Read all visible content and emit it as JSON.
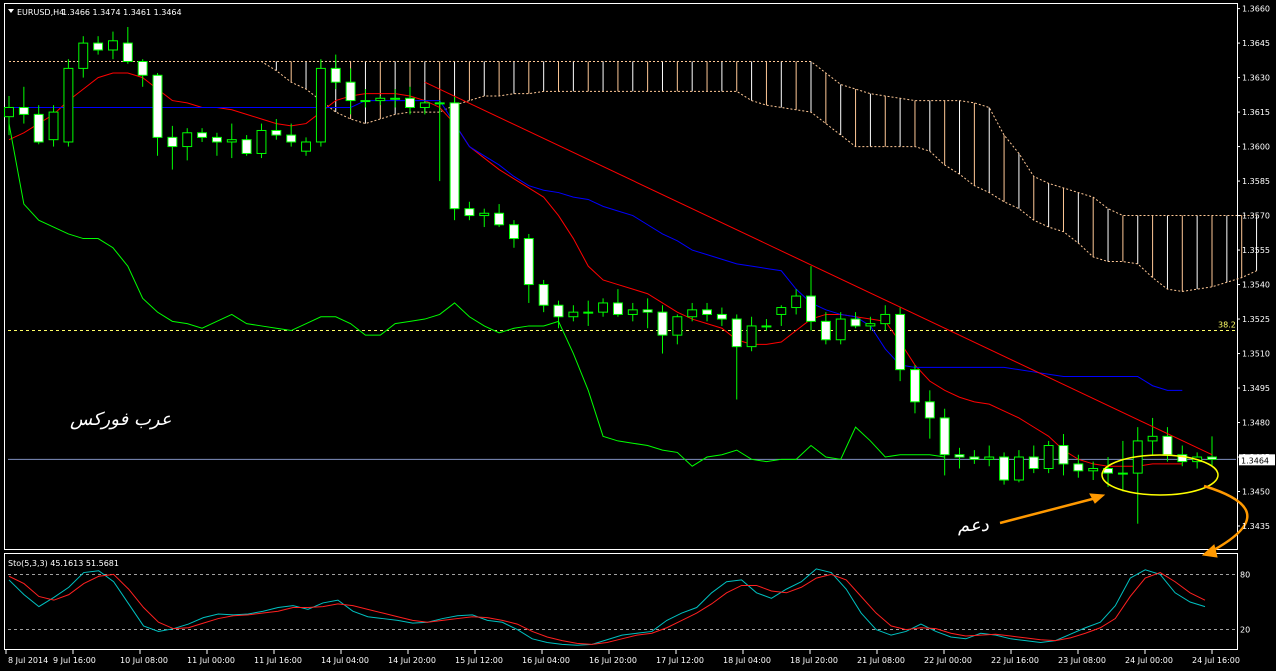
{
  "header": {
    "symbol_label": "EURUSD,H4",
    "ohlc": "1.3466 1.3474 1.3461 1.3464"
  },
  "watermark": "عرب فوركس",
  "annotation": {
    "support_label": "دعم"
  },
  "fib_label": "38.2",
  "current_price_label": "1.3464",
  "oscillator": {
    "title": "Sto(5,3,3) 45.1613 51.5681",
    "levels": [
      80,
      20
    ],
    "level_labels": [
      "80",
      "20"
    ],
    "range": [
      0,
      100
    ],
    "main_color": "#00c0c0",
    "signal_color": "#ff2020",
    "main": [
      74,
      58,
      45,
      55,
      66,
      82,
      84,
      72,
      48,
      24,
      18,
      21,
      26,
      33,
      37,
      36,
      37,
      40,
      44,
      46,
      42,
      49,
      52,
      40,
      34,
      32,
      30,
      27,
      28,
      32,
      35,
      36,
      30,
      28,
      20,
      10,
      6,
      4,
      3,
      4,
      9,
      14,
      16,
      18,
      30,
      38,
      44,
      60,
      72,
      74,
      60,
      54,
      64,
      72,
      86,
      82,
      64,
      38,
      20,
      14,
      18,
      26,
      18,
      12,
      10,
      16,
      14,
      10,
      8,
      6,
      8,
      15,
      22,
      28,
      46,
      76,
      85,
      80,
      60,
      50,
      45
    ],
    "signal": [
      78,
      70,
      56,
      52,
      58,
      70,
      78,
      80,
      64,
      44,
      28,
      21,
      22,
      27,
      32,
      35,
      36,
      38,
      40,
      44,
      44,
      45,
      48,
      46,
      42,
      38,
      34,
      30,
      28,
      30,
      32,
      34,
      33,
      30,
      26,
      18,
      12,
      8,
      5,
      4,
      6,
      10,
      14,
      16,
      22,
      30,
      38,
      48,
      60,
      68,
      68,
      62,
      60,
      66,
      76,
      80,
      74,
      56,
      38,
      24,
      20,
      22,
      21,
      16,
      13,
      14,
      15,
      13,
      11,
      9,
      8,
      11,
      16,
      22,
      32,
      56,
      76,
      82,
      72,
      60,
      52
    ]
  },
  "axis": {
    "price_labels": [
      "1.3660",
      "1.3645",
      "1.3630",
      "1.3615",
      "1.3600",
      "1.3585",
      "1.3570",
      "1.3555",
      "1.3540",
      "1.3525",
      "1.3510",
      "1.3495",
      "1.3480",
      "1.3465",
      "1.3450",
      "1.3435"
    ],
    "time_labels": [
      "8 Jul 2014",
      "9 Jul 16:00",
      "10 Jul 08:00",
      "11 Jul 00:00",
      "11 Jul 16:00",
      "14 Jul 04:00",
      "14 Jul 20:00",
      "15 Jul 12:00",
      "16 Jul 04:00",
      "16 Jul 20:00",
      "17 Jul 12:00",
      "18 Jul 04:00",
      "18 Jul 20:00",
      "21 Jul 08:00",
      "22 Jul 00:00",
      "22 Jul 16:00",
      "23 Jul 08:00",
      "24 Jul 00:00",
      "24 Jul 16:00"
    ]
  },
  "colors": {
    "bull": "#ffffff",
    "bear": "#ffffff",
    "wick": "#00ff00",
    "tenkan": "#ff0000",
    "kijun": "#0000ff",
    "chikou": "#00ff00",
    "cloud_a": "#ffc896",
    "cloud_b": "#ffffff",
    "trendline": "#ff0000",
    "ellipse": "#ffff00",
    "arrow": "#ff9900",
    "fib": "#ffff66",
    "price_line": "#8090c0"
  },
  "chart_data": {
    "type": "candlestick",
    "title": "EURUSD,H4",
    "ylim": [
      1.3425,
      1.3662
    ],
    "price_ticks": [
      1.366,
      1.3645,
      1.363,
      1.3615,
      1.36,
      1.3585,
      1.357,
      1.3555,
      1.354,
      1.3525,
      1.351,
      1.3495,
      1.348,
      1.3465,
      1.345,
      1.3435
    ],
    "current_price": 1.3464,
    "fib_level": 1.352,
    "candles": [
      [
        1.3613,
        1.3622,
        1.3605,
        1.3617
      ],
      [
        1.3617,
        1.3626,
        1.361,
        1.3614
      ],
      [
        1.3614,
        1.3618,
        1.3601,
        1.3602
      ],
      [
        1.3603,
        1.3618,
        1.36,
        1.3615
      ],
      [
        1.3602,
        1.3638,
        1.36,
        1.3634
      ],
      [
        1.3634,
        1.3648,
        1.363,
        1.3645
      ],
      [
        1.3645,
        1.3648,
        1.364,
        1.3642
      ],
      [
        1.3642,
        1.365,
        1.3638,
        1.3646
      ],
      [
        1.3645,
        1.3652,
        1.3636,
        1.3637
      ],
      [
        1.3637,
        1.3638,
        1.3626,
        1.3631
      ],
      [
        1.3631,
        1.3632,
        1.3596,
        1.3604
      ],
      [
        1.3604,
        1.3609,
        1.359,
        1.36
      ],
      [
        1.36,
        1.3608,
        1.3594,
        1.3606
      ],
      [
        1.3606,
        1.3608,
        1.3602,
        1.3604
      ],
      [
        1.3604,
        1.3606,
        1.3596,
        1.3602
      ],
      [
        1.3602,
        1.361,
        1.3595,
        1.3603
      ],
      [
        1.3603,
        1.3605,
        1.3596,
        1.3597
      ],
      [
        1.3597,
        1.361,
        1.3595,
        1.3607
      ],
      [
        1.3607,
        1.3612,
        1.3603,
        1.3605
      ],
      [
        1.3605,
        1.361,
        1.36,
        1.3602
      ],
      [
        1.3598,
        1.3604,
        1.3596,
        1.3602
      ],
      [
        1.3602,
        1.3638,
        1.36,
        1.3634
      ],
      [
        1.3634,
        1.364,
        1.3625,
        1.3628
      ],
      [
        1.3628,
        1.3634,
        1.3614,
        1.362
      ],
      [
        1.362,
        1.3625,
        1.3617,
        1.362
      ],
      [
        1.362,
        1.3622,
        1.3618,
        1.3621
      ],
      [
        1.3621,
        1.3625,
        1.3617,
        1.3621
      ],
      [
        1.3621,
        1.3626,
        1.3614,
        1.3617
      ],
      [
        1.3617,
        1.362,
        1.3614,
        1.3619
      ],
      [
        1.3619,
        1.362,
        1.3585,
        1.3619
      ],
      [
        1.3619,
        1.3622,
        1.3568,
        1.3573
      ],
      [
        1.3573,
        1.3576,
        1.3568,
        1.357
      ],
      [
        1.357,
        1.3573,
        1.3565,
        1.3571
      ],
      [
        1.3571,
        1.3575,
        1.3565,
        1.3566
      ],
      [
        1.3566,
        1.3568,
        1.3556,
        1.356
      ],
      [
        1.356,
        1.3562,
        1.3532,
        1.354
      ],
      [
        1.354,
        1.3542,
        1.3528,
        1.3531
      ],
      [
        1.3531,
        1.3533,
        1.3521,
        1.3526
      ],
      [
        1.3526,
        1.3531,
        1.3524,
        1.3528
      ],
      [
        1.3528,
        1.3533,
        1.3522,
        1.3528
      ],
      [
        1.3528,
        1.3534,
        1.3526,
        1.3532
      ],
      [
        1.3532,
        1.3538,
        1.3526,
        1.3527
      ],
      [
        1.3527,
        1.3532,
        1.3524,
        1.3529
      ],
      [
        1.3529,
        1.3534,
        1.3521,
        1.3528
      ],
      [
        1.3528,
        1.3531,
        1.351,
        1.3518
      ],
      [
        1.3518,
        1.3527,
        1.3514,
        1.3526
      ],
      [
        1.3526,
        1.3532,
        1.3524,
        1.3529
      ],
      [
        1.3529,
        1.3532,
        1.3524,
        1.3527
      ],
      [
        1.3527,
        1.353,
        1.3522,
        1.3525
      ],
      [
        1.3525,
        1.3527,
        1.349,
        1.3513
      ],
      [
        1.3513,
        1.3526,
        1.3511,
        1.3522
      ],
      [
        1.3522,
        1.3525,
        1.352,
        1.3522
      ],
      [
        1.3527,
        1.3531,
        1.3522,
        1.353
      ],
      [
        1.353,
        1.3538,
        1.3527,
        1.3535
      ],
      [
        1.3535,
        1.3548,
        1.352,
        1.3524
      ],
      [
        1.3524,
        1.3528,
        1.3514,
        1.3516
      ],
      [
        1.3516,
        1.3528,
        1.3514,
        1.3525
      ],
      [
        1.3525,
        1.3528,
        1.3521,
        1.3522
      ],
      [
        1.3522,
        1.3526,
        1.352,
        1.3523
      ],
      [
        1.3523,
        1.3531,
        1.352,
        1.3527
      ],
      [
        1.3527,
        1.353,
        1.3498,
        1.3503
      ],
      [
        1.3503,
        1.3505,
        1.3484,
        1.3489
      ],
      [
        1.3489,
        1.3494,
        1.3473,
        1.3482
      ],
      [
        1.3482,
        1.3486,
        1.3457,
        1.3466
      ],
      [
        1.3466,
        1.3469,
        1.346,
        1.3465
      ],
      [
        1.3465,
        1.3468,
        1.3462,
        1.3464
      ],
      [
        1.3464,
        1.347,
        1.3461,
        1.3465
      ],
      [
        1.3465,
        1.3467,
        1.3453,
        1.3455
      ],
      [
        1.3455,
        1.3468,
        1.3454,
        1.3465
      ],
      [
        1.3465,
        1.347,
        1.3458,
        1.346
      ],
      [
        1.346,
        1.3472,
        1.3458,
        1.347
      ],
      [
        1.347,
        1.3475,
        1.3457,
        1.3462
      ],
      [
        1.3462,
        1.3466,
        1.3456,
        1.3459
      ],
      [
        1.3459,
        1.3463,
        1.3455,
        1.346
      ],
      [
        1.346,
        1.3465,
        1.3452,
        1.3458
      ],
      [
        1.3458,
        1.3472,
        1.345,
        1.3458
      ],
      [
        1.3458,
        1.3478,
        1.3436,
        1.3472
      ],
      [
        1.3472,
        1.3482,
        1.3466,
        1.3474
      ],
      [
        1.3474,
        1.3478,
        1.3463,
        1.3466
      ],
      [
        1.3466,
        1.347,
        1.3461,
        1.3463
      ],
      [
        1.3463,
        1.3467,
        1.346,
        1.3465
      ],
      [
        1.3465,
        1.3474,
        1.3461,
        1.3464
      ]
    ],
    "tenkan": [
      1.3603,
      1.3606,
      1.361,
      1.3614,
      1.362,
      1.3625,
      1.363,
      1.3632,
      1.3632,
      1.363,
      1.3625,
      1.362,
      1.3619,
      1.3617,
      1.3617,
      1.3616,
      1.3614,
      1.3612,
      1.361,
      1.3609,
      1.361,
      1.3615,
      1.362,
      1.3622,
      1.3623,
      1.3623,
      1.3623,
      1.3622,
      1.362,
      1.3617,
      1.361,
      1.36,
      1.3595,
      1.359,
      1.3586,
      1.3582,
      1.3578,
      1.357,
      1.356,
      1.3548,
      1.3542,
      1.354,
      1.3538,
      1.3536,
      1.3532,
      1.3528,
      1.3525,
      1.3523,
      1.3521,
      1.3516,
      1.3514,
      1.3514,
      1.3515,
      1.352,
      1.3525,
      1.3527,
      1.3527,
      1.3526,
      1.3525,
      1.3524,
      1.3515,
      1.3505,
      1.3498,
      1.3494,
      1.3491,
      1.3489,
      1.3488,
      1.3485,
      1.3482,
      1.3478,
      1.3474,
      1.3468,
      1.3464,
      1.3462,
      1.3461,
      1.3461,
      1.3461,
      1.3462,
      1.3462,
      1.3462
    ],
    "kijun": [
      1.3617,
      1.3617,
      1.3617,
      1.3617,
      1.3617,
      1.3617,
      1.3617,
      1.3617,
      1.3617,
      1.3617,
      1.3617,
      1.3617,
      1.3617,
      1.3617,
      1.3617,
      1.3617,
      1.3617,
      1.3617,
      1.3617,
      1.3617,
      1.3617,
      1.3617,
      1.3617,
      1.3617,
      1.362,
      1.362,
      1.362,
      1.362,
      1.362,
      1.362,
      1.361,
      1.36,
      1.3596,
      1.3592,
      1.3587,
      1.3583,
      1.3581,
      1.358,
      1.3578,
      1.3577,
      1.3574,
      1.3572,
      1.357,
      1.3566,
      1.3562,
      1.3559,
      1.3555,
      1.3553,
      1.3551,
      1.3549,
      1.3548,
      1.3547,
      1.3546,
      1.3538,
      1.3532,
      1.3529,
      1.3527,
      1.3526,
      1.3522,
      1.3512,
      1.3505,
      1.3504,
      1.3504,
      1.3504,
      1.3504,
      1.3504,
      1.3504,
      1.3504,
      1.3503,
      1.3502,
      1.3501,
      1.35,
      1.35,
      1.35,
      1.35,
      1.35,
      1.35,
      1.3496,
      1.3494,
      1.3494
    ],
    "chikou": [
      1.361,
      1.3575,
      1.3568,
      1.3565,
      1.3562,
      1.356,
      1.356,
      1.3556,
      1.3548,
      1.3534,
      1.3528,
      1.3524,
      1.3523,
      1.3521,
      1.3524,
      1.3527,
      1.3523,
      1.3522,
      1.3521,
      1.352,
      1.3523,
      1.3526,
      1.3526,
      1.3523,
      1.3518,
      1.3518,
      1.3523,
      1.3524,
      1.3525,
      1.3527,
      1.3532,
      1.3526,
      1.3522,
      1.3519,
      1.3521,
      1.3522,
      1.3522,
      1.3524,
      1.351,
      1.3494,
      1.3474,
      1.3472,
      1.3471,
      1.347,
      1.3468,
      1.3467,
      1.3461,
      1.3465,
      1.3466,
      1.3468,
      1.3464,
      1.3463,
      1.3464,
      1.3464,
      1.347,
      1.3465,
      1.3464,
      1.3478,
      1.3472,
      1.3465,
      1.3466,
      1.3466,
      1.3466,
      1.3465
    ],
    "cloud_upper": [
      1.3637,
      1.3637,
      1.3637,
      1.3637,
      1.3637,
      1.3637,
      1.3637,
      1.3637,
      1.3637,
      1.3637,
      1.3637,
      1.3637,
      1.3637,
      1.3637,
      1.3637,
      1.3637,
      1.3637,
      1.3637,
      1.3637,
      1.3637,
      1.3637,
      1.3637,
      1.3637,
      1.3637,
      1.3637,
      1.3637,
      1.3637,
      1.3637,
      1.3637,
      1.3637,
      1.3637,
      1.3637,
      1.3637,
      1.3637,
      1.3637,
      1.3637,
      1.3637,
      1.3637,
      1.3637,
      1.3637,
      1.3637,
      1.3637,
      1.3637,
      1.3637,
      1.3637,
      1.3637,
      1.3637,
      1.3637,
      1.3637,
      1.3637,
      1.3637,
      1.3637,
      1.3637,
      1.3637,
      1.3637,
      1.3632,
      1.3627,
      1.3625,
      1.3623,
      1.3622,
      1.3621,
      1.362,
      1.362,
      1.362,
      1.362,
      1.3619,
      1.3617,
      1.3605,
      1.3597,
      1.3587,
      1.3584,
      1.3582,
      1.358,
      1.3578,
      1.3573,
      1.357,
      1.357,
      1.357,
      1.357,
      1.357,
      1.357,
      1.357,
      1.357,
      1.357,
      1.357
    ],
    "cloud_lower": [
      1.3637,
      1.3637,
      1.3637,
      1.3637,
      1.3637,
      1.3637,
      1.3637,
      1.3637,
      1.3637,
      1.3637,
      1.3637,
      1.3637,
      1.3637,
      1.3637,
      1.3637,
      1.3637,
      1.3637,
      1.3637,
      1.3633,
      1.3628,
      1.3625,
      1.362,
      1.3615,
      1.3612,
      1.361,
      1.3612,
      1.3614,
      1.3615,
      1.3615,
      1.3615,
      1.3618,
      1.362,
      1.3622,
      1.3622,
      1.3623,
      1.3623,
      1.3624,
      1.3624,
      1.3624,
      1.3624,
      1.3624,
      1.3624,
      1.3624,
      1.3624,
      1.3624,
      1.3624,
      1.3624,
      1.3624,
      1.3624,
      1.3624,
      1.362,
      1.3618,
      1.3617,
      1.3616,
      1.3615,
      1.361,
      1.3605,
      1.36,
      1.36,
      1.36,
      1.36,
      1.36,
      1.3598,
      1.3592,
      1.3588,
      1.3583,
      1.358,
      1.3576,
      1.3573,
      1.3568,
      1.3565,
      1.3563,
      1.3558,
      1.3552,
      1.355,
      1.355,
      1.3549,
      1.3543,
      1.3538,
      1.3537,
      1.3538,
      1.3539,
      1.3541,
      1.3543,
      1.3546
    ],
    "trendline": {
      "from": [
        28,
        1.3628
      ],
      "to": [
        81,
        1.3466
      ]
    },
    "oscillator_levels": [
      80,
      20
    ],
    "time_ticks": [
      "8 Jul 2014",
      "9 Jul 16:00",
      "10 Jul 08:00",
      "11 Jul 00:00",
      "11 Jul 16:00",
      "14 Jul 04:00",
      "14 Jul 20:00",
      "15 Jul 12:00",
      "16 Jul 04:00",
      "16 Jul 20:00",
      "17 Jul 12:00",
      "18 Jul 04:00",
      "18 Jul 20:00",
      "21 Jul 08:00",
      "22 Jul 00:00",
      "22 Jul 16:00",
      "23 Jul 08:00",
      "24 Jul 00:00",
      "24 Jul 16:00"
    ]
  }
}
